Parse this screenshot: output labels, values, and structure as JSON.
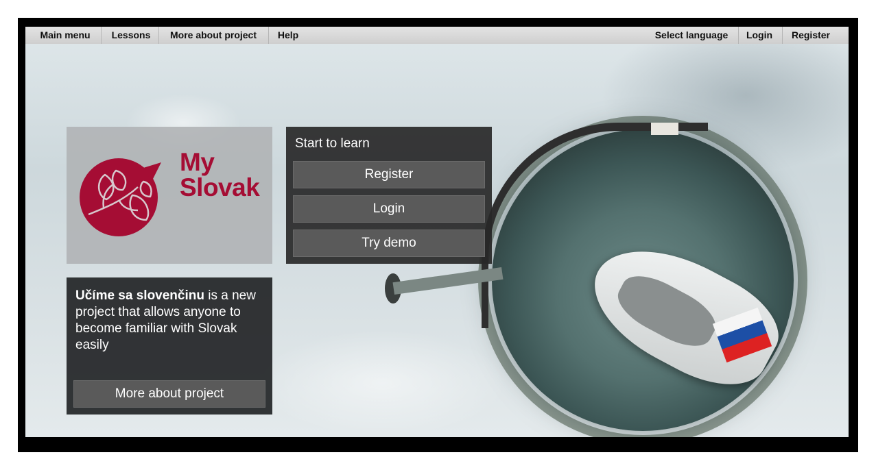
{
  "menu": {
    "left": [
      "Main menu",
      "Lessons",
      "More about project",
      "Help"
    ],
    "right": [
      "Select language",
      "Login",
      "Register"
    ]
  },
  "logo": {
    "line1": "My",
    "line2": "Slovak",
    "color": "#a50d34"
  },
  "start": {
    "title": "Start to learn",
    "register": "Register",
    "login": "Login",
    "demo": "Try demo"
  },
  "info": {
    "bold": "Učíme sa slovenčinu",
    "rest": " is a new project that allows anyone to become familiar with Slovak easily",
    "button": "More about project"
  }
}
